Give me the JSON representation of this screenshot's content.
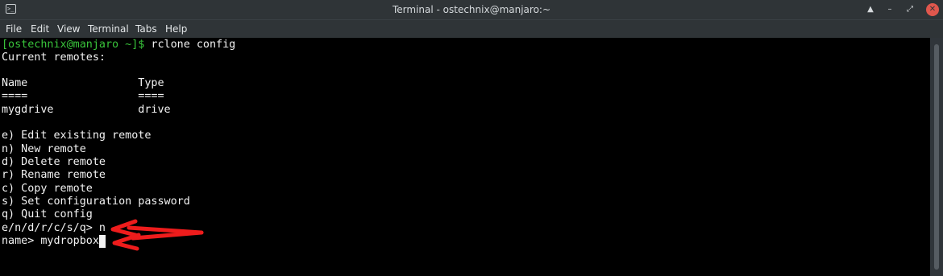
{
  "window": {
    "title": "Terminal - ostechnix@manjaro:~",
    "app_icon_glyph": ">_",
    "buttons": {
      "shade": "▲",
      "minimize": "–",
      "maximize": "⤢",
      "close": "✕"
    }
  },
  "menu": [
    "File",
    "Edit",
    "View",
    "Terminal",
    "Tabs",
    "Help"
  ],
  "terminal": {
    "prompt": "[ostechnix@manjaro ~]$",
    "command": " rclone config",
    "lines": [
      "Current remotes:",
      "",
      "Name                 Type",
      "====                 ====",
      "mygdrive             drive",
      "",
      "e) Edit existing remote",
      "n) New remote",
      "d) Delete remote",
      "r) Rename remote",
      "c) Copy remote",
      "s) Set configuration password",
      "q) Quit config",
      "e/n/d/r/c/s/q> n",
      "name> mydropbox"
    ]
  },
  "colors": {
    "terminal_bg": "#000000",
    "terminal_fg": "#f2f2f2",
    "prompt": "#39c43b",
    "titlebar": "#2f3437",
    "annotation_arrow": "#ee1c1c"
  }
}
